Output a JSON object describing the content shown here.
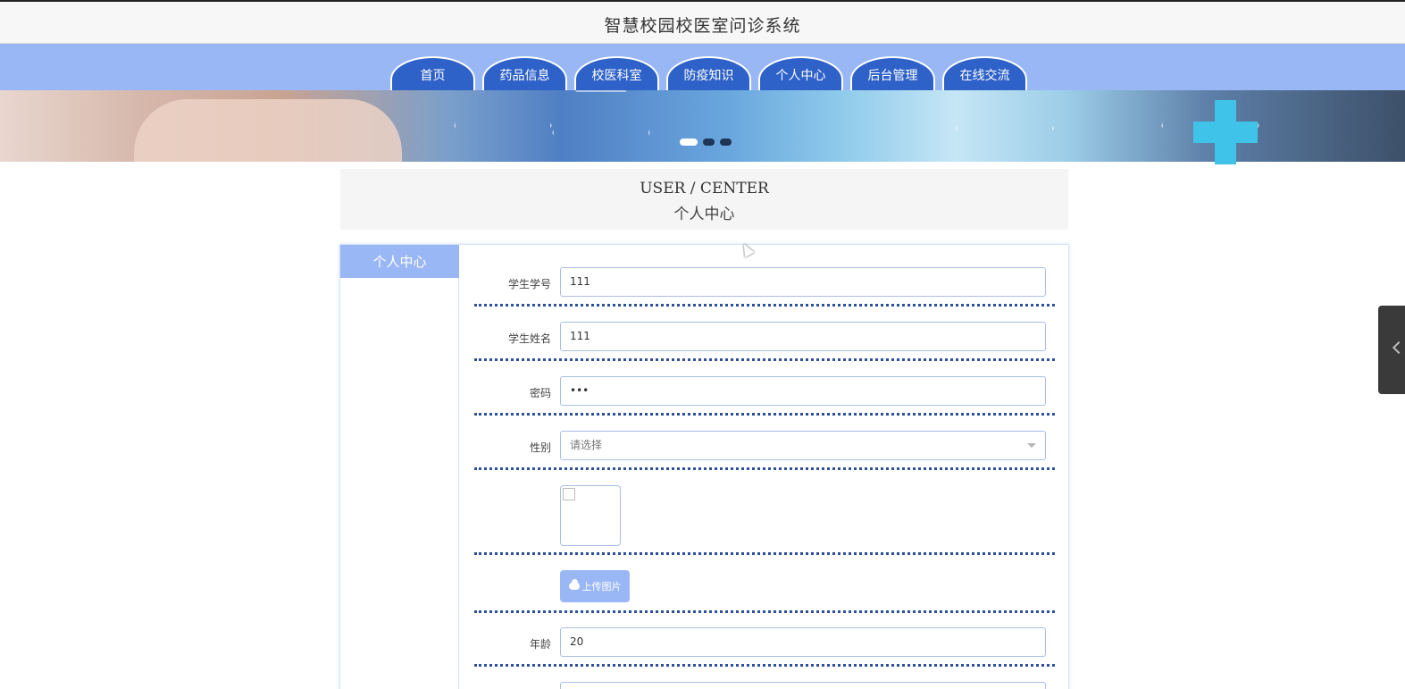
{
  "header": {
    "title": "智慧校园校医室问诊系统"
  },
  "nav": {
    "items": [
      {
        "label": "首页"
      },
      {
        "label": "药品信息"
      },
      {
        "label": "校医科室"
      },
      {
        "label": "防疫知识"
      },
      {
        "label": "个人中心"
      },
      {
        "label": "后台管理"
      },
      {
        "label": "在线交流"
      }
    ]
  },
  "section": {
    "title_en": "USER / CENTER",
    "title_cn": "个人中心"
  },
  "sidebar": {
    "items": [
      {
        "label": "个人中心",
        "active": true
      }
    ]
  },
  "form": {
    "student_id": {
      "label": "学生学号",
      "value": "111"
    },
    "student_name": {
      "label": "学生姓名",
      "value": "111"
    },
    "password": {
      "label": "密码",
      "value": "•••"
    },
    "gender": {
      "label": "性别",
      "placeholder": "请选择"
    },
    "upload": {
      "label": "上传图片"
    },
    "age": {
      "label": "年龄",
      "value": "20"
    }
  },
  "colors": {
    "nav_bg": "#9ab7f5",
    "tab_bg": "#2f62c9",
    "divider": "#2e4f9a"
  }
}
